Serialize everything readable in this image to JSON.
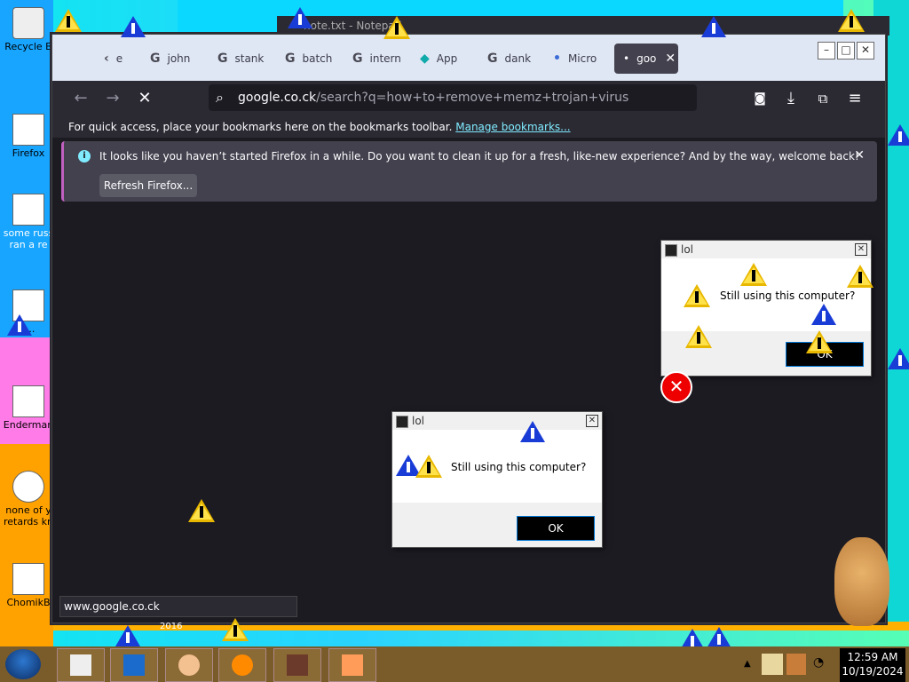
{
  "desktop": {
    "icons": [
      {
        "label": "Recycle B",
        "icon": "recycle-bin-icon"
      },
      {
        "label": "Firefox",
        "icon": "firefox-icon"
      },
      {
        "label": "some russ ran a re",
        "icon": "ie-icon"
      },
      {
        "label": "t...",
        "icon": "folder-icon"
      },
      {
        "label": "Enderman",
        "icon": "document-icon"
      },
      {
        "label": "none of y retards kn",
        "icon": "skype-icon"
      },
      {
        "label": "ChomikB",
        "icon": "app-icon"
      }
    ]
  },
  "browser": {
    "tabs": [
      {
        "label": "e",
        "icon": "back-arrow-icon"
      },
      {
        "label": "john",
        "icon": "google-g-icon"
      },
      {
        "label": "stank",
        "icon": "google-g-icon"
      },
      {
        "label": "batch",
        "icon": "google-g-icon"
      },
      {
        "label": "intern",
        "icon": "google-g-icon"
      },
      {
        "label": "App",
        "icon": "app-icon"
      },
      {
        "label": "dank",
        "icon": "google-g-icon"
      },
      {
        "label": "Micro",
        "icon": "dot-icon"
      },
      {
        "label": "goo",
        "icon": "dot-icon",
        "active": true
      }
    ],
    "behind_title": "note.txt - Notepad",
    "url_host": "google.co.ck",
    "url_path": "/search?q=how+to+remove+memz+trojan+virus",
    "bookmarks_text": "For quick access, place your bookmarks here on the bookmarks toolbar.",
    "bookmarks_link": "Manage bookmarks...",
    "notice_text": "It looks like you haven’t started Firefox in a while. Do you want to clean it up for a fresh, like-new experience? And by the way, welcome back!",
    "refresh_label": "Refresh Firefox...",
    "status_url": "www.google.co.ck"
  },
  "dialogs": [
    {
      "title": "lol",
      "message": "Still using this computer?",
      "ok": "OK"
    },
    {
      "title": "lol",
      "message": "Still using this computer?",
      "ok": "OK"
    }
  ],
  "taskbar": {
    "time": "12:59 AM",
    "date": "10/19/2024"
  },
  "bottom_text": "2016",
  "colors": {
    "firefox_dark": "#1c1b22",
    "firefox_toolbar": "#2b2a33",
    "link": "#80ebff",
    "warning_yellow": "#ffe14a",
    "warning_blue": "#1a3cd6"
  }
}
